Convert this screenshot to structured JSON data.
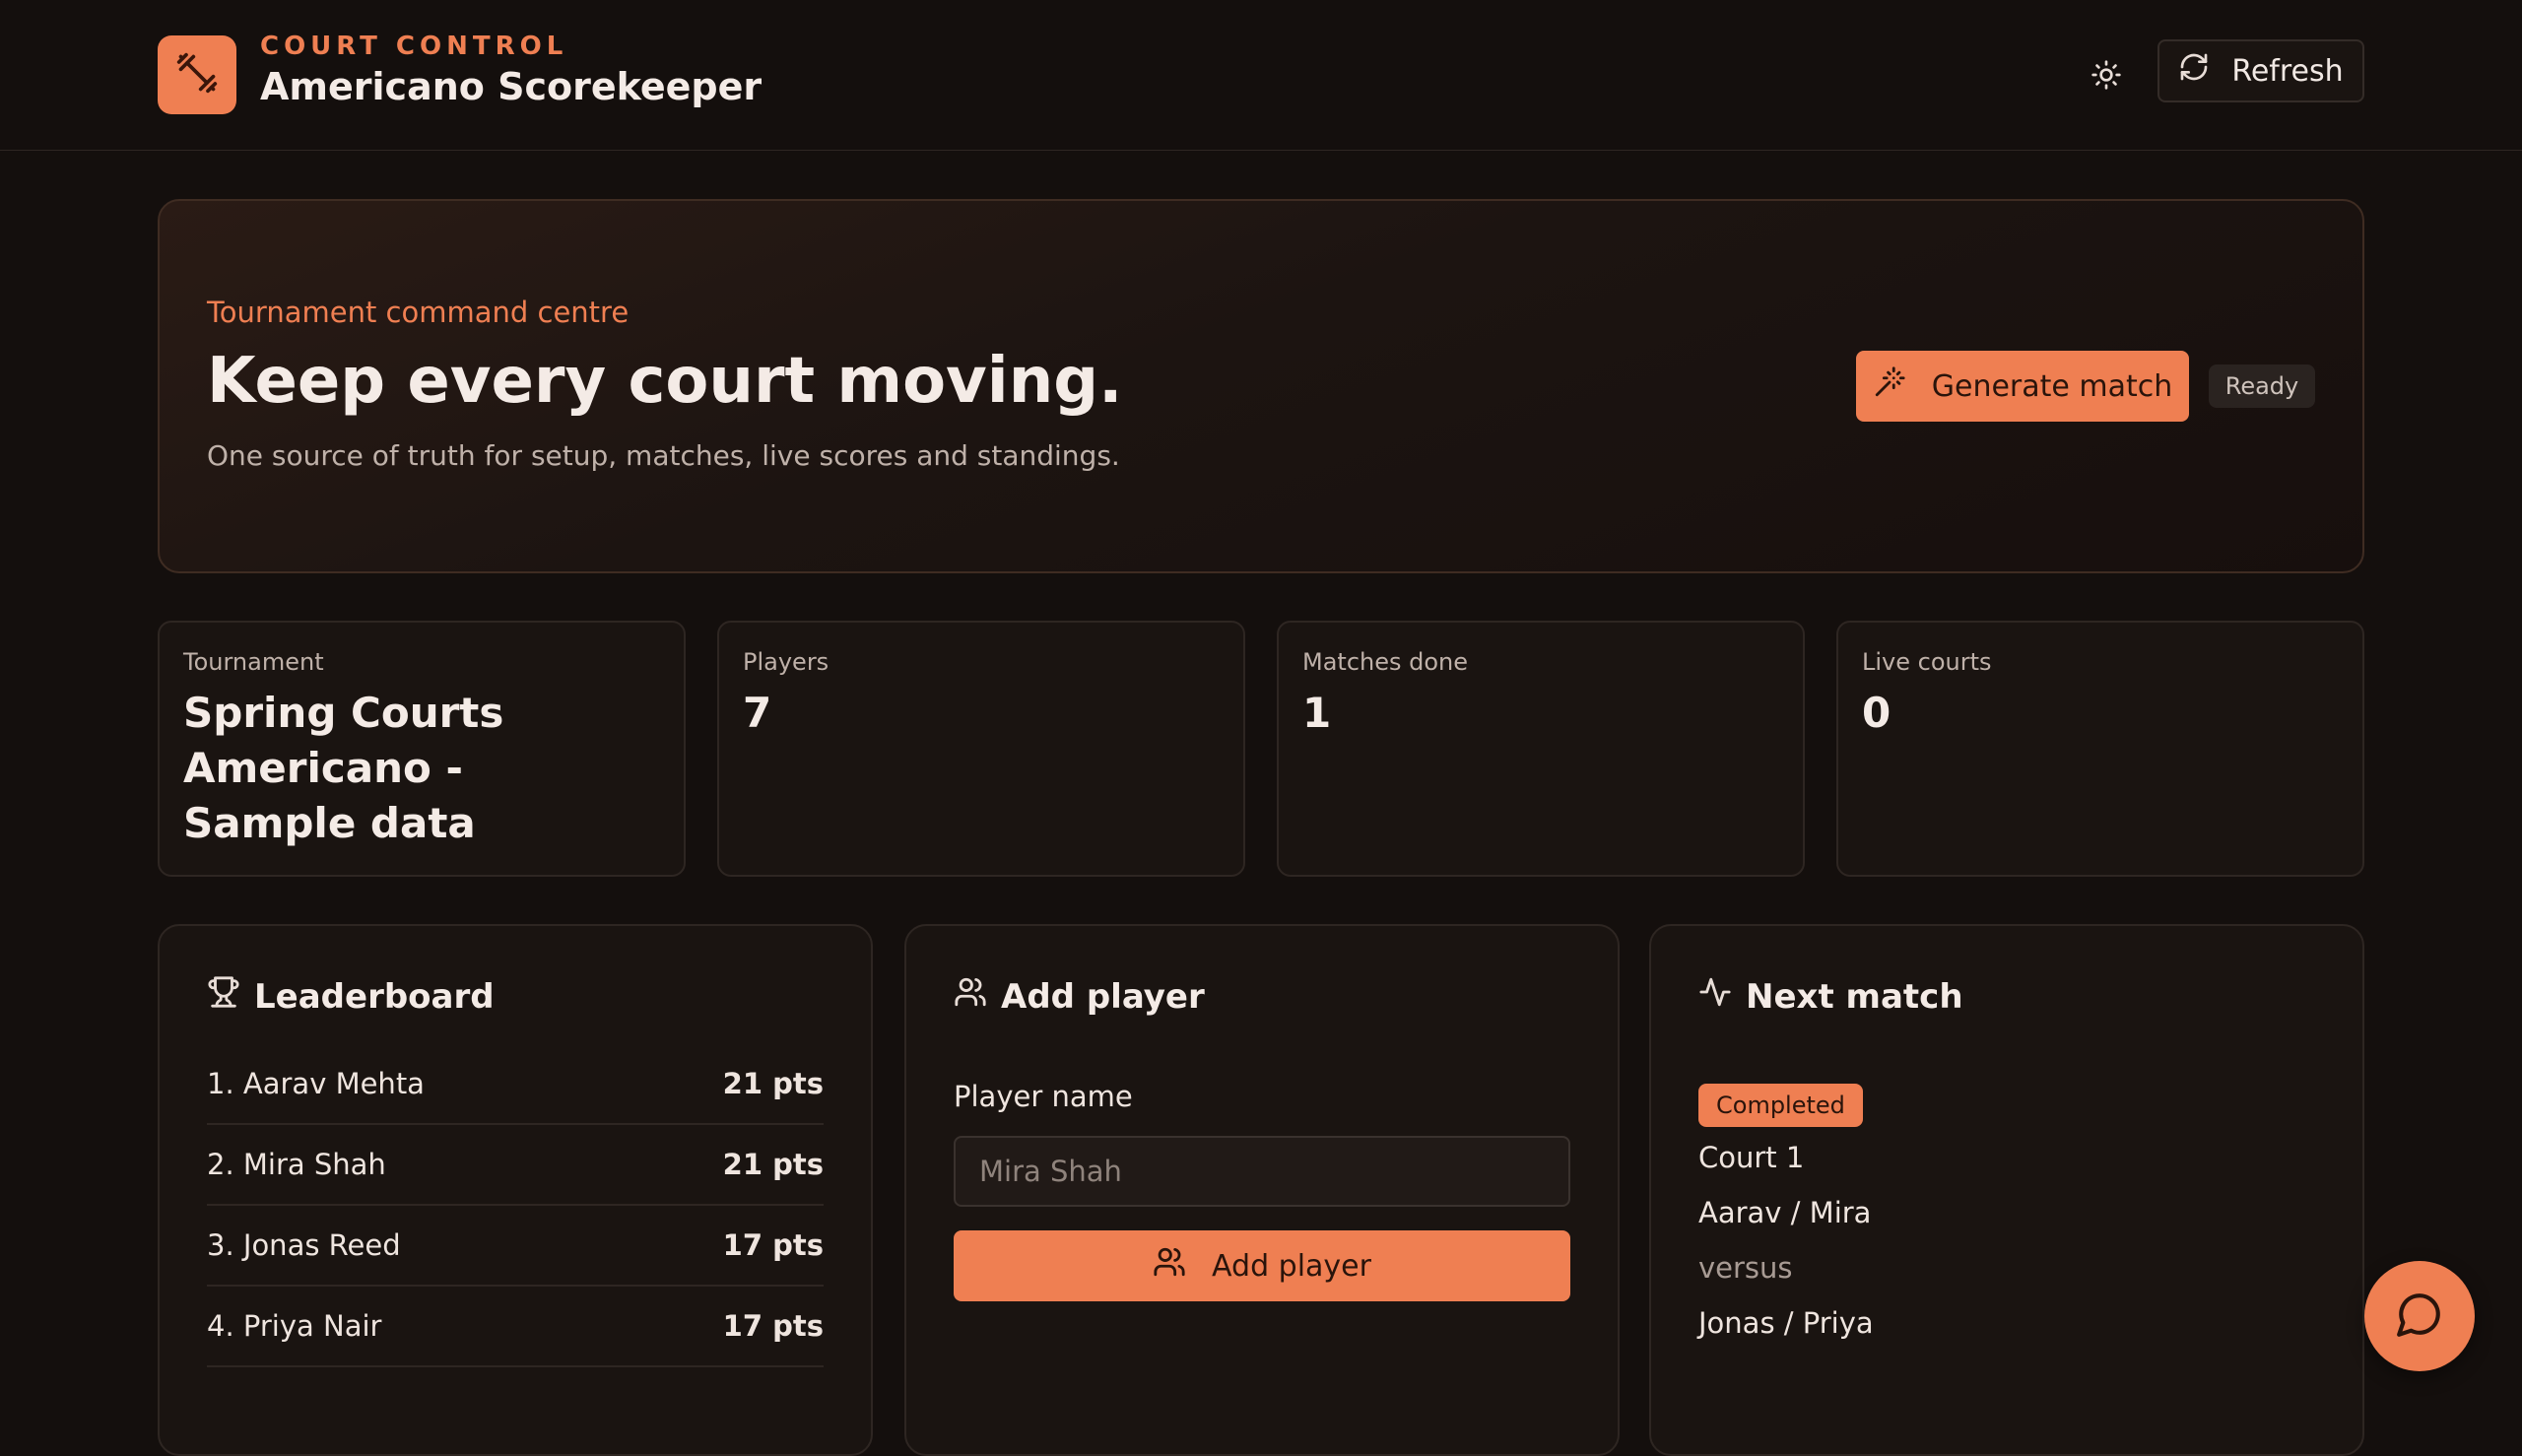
{
  "header": {
    "kicker": "COURT CONTROL",
    "title": "Americano Scorekeeper",
    "logo_icon": "dumbbell-icon",
    "theme_icon": "sun-icon",
    "refresh_label": "Refresh",
    "refresh_icon": "refresh-icon"
  },
  "hero": {
    "kicker": "Tournament command centre",
    "title": "Keep every court moving.",
    "subtitle": "One source of truth for setup, matches, live scores and standings.",
    "generate_label": "Generate match",
    "generate_icon": "magic-wand-icon",
    "status": "Ready"
  },
  "stats": [
    {
      "label": "Tournament",
      "value": "Spring Courts Americano - Sample data"
    },
    {
      "label": "Players",
      "value": "7"
    },
    {
      "label": "Matches done",
      "value": "1"
    },
    {
      "label": "Live courts",
      "value": "0"
    }
  ],
  "leaderboard": {
    "title": "Leaderboard",
    "icon": "trophy-icon",
    "rows": [
      {
        "name": "1. Aarav Mehta",
        "points": "21 pts"
      },
      {
        "name": "2. Mira Shah",
        "points": "21 pts"
      },
      {
        "name": "3. Jonas Reed",
        "points": "17 pts"
      },
      {
        "name": "4. Priya Nair",
        "points": "17 pts"
      }
    ]
  },
  "add_player": {
    "title": "Add player",
    "icon": "users-icon",
    "field_label": "Player name",
    "placeholder": "Mira Shah",
    "button_label": "Add player"
  },
  "next_match": {
    "title": "Next match",
    "icon": "activity-icon",
    "status": "Completed",
    "court": "Court 1",
    "team_a": "Aarav / Mira",
    "versus": "versus",
    "team_b": "Jonas / Priya"
  },
  "colors": {
    "accent": "#ef7f52",
    "background": "#140f0d",
    "panel": "#1a1411"
  },
  "chat_icon": "chat-bubble-icon"
}
